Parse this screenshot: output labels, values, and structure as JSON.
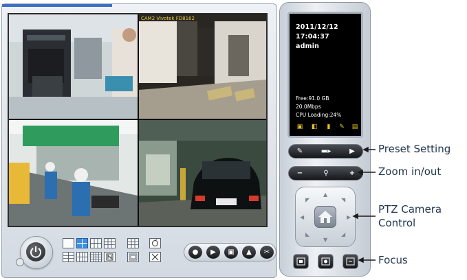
{
  "camera_view": {
    "cam2_label": "CAM2 Vivotek FD8162"
  },
  "info_screen": {
    "date": "2011/12/12",
    "time": "17:04:37",
    "user": "admin",
    "free_space": "Free:91.0 GB",
    "bitrate": "20.0Mbps",
    "cpu_loading": "CPU Loading:24%",
    "status_icons": [
      "monitor-icon",
      "speaker-icon",
      "battery-icon",
      "network-icon",
      "keyboard-icon"
    ]
  },
  "callouts": {
    "preset_setting": "Preset Setting",
    "zoom": "Zoom in/out",
    "ptz_line1": "PTZ Camera",
    "ptz_line2": "Control",
    "focus": "Focus"
  },
  "colors": {
    "accent": "#3f8ee0",
    "info_text": "#ffffff",
    "status_icon": "#e8c322",
    "callout_text": "#22374e"
  }
}
